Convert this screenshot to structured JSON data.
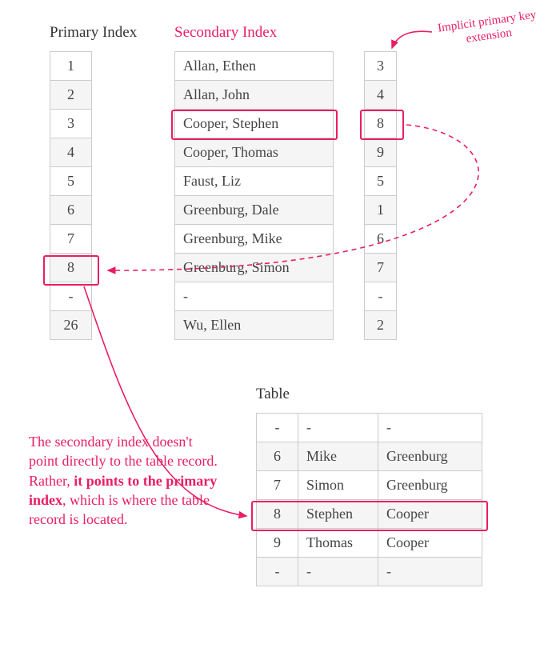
{
  "headers": {
    "primary": "Primary Index",
    "secondary": "Secondary Index",
    "table": "Table"
  },
  "primary_index": [
    "1",
    "2",
    "3",
    "4",
    "5",
    "6",
    "7",
    "8",
    "-",
    "26"
  ],
  "secondary_index_names": [
    "Allan, Ethen",
    "Allan, John",
    "Cooper, Stephen",
    "Cooper, Thomas",
    "Faust, Liz",
    "Greenburg, Dale",
    "Greenburg, Mike",
    "Greenburg, Simon",
    "-",
    "Wu, Ellen"
  ],
  "secondary_index_keys": [
    "3",
    "4",
    "8",
    "9",
    "5",
    "1",
    "6",
    "7",
    "-",
    "2"
  ],
  "table_rows": [
    [
      "-",
      "-",
      "-"
    ],
    [
      "6",
      "Mike",
      "Greenburg"
    ],
    [
      "7",
      "Simon",
      "Greenburg"
    ],
    [
      "8",
      "Stephen",
      "Cooper"
    ],
    [
      "9",
      "Thomas",
      "Cooper"
    ],
    [
      "-",
      "-",
      "-"
    ]
  ],
  "highlight": {
    "primary_row_index": 7,
    "secondary_row_index": 2,
    "table_row_index": 3
  },
  "annotations": {
    "implicit": "Implicit primary key extension",
    "explanation_parts": {
      "p1": "The secondary index doesn't point directly to the table record. Rather, ",
      "p2": "it points to the primary index",
      "p3": ", which is where the table record is located."
    }
  }
}
